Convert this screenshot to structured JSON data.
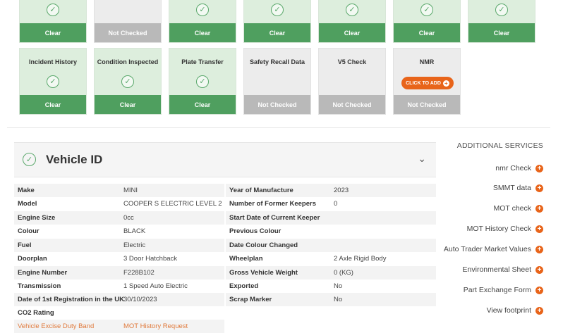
{
  "tiles_row1": [
    {
      "label": "",
      "status": "Clear",
      "checked": true
    },
    {
      "label": "",
      "status": "Not Checked",
      "checked": false
    },
    {
      "label": "",
      "status": "Clear",
      "checked": true
    },
    {
      "label": "",
      "status": "Clear",
      "checked": true
    },
    {
      "label": "",
      "status": "Clear",
      "checked": true
    },
    {
      "label": "",
      "status": "Clear",
      "checked": true
    },
    {
      "label": "",
      "status": "Clear",
      "checked": true
    }
  ],
  "tiles_row2": [
    {
      "label": "Incident History",
      "status": "Clear",
      "checked": true
    },
    {
      "label": "Condition Inspected",
      "status": "Clear",
      "checked": true
    },
    {
      "label": "Plate Transfer",
      "status": "Clear",
      "checked": true
    },
    {
      "label": "Safety Recall Data",
      "status": "Not Checked",
      "checked": false
    },
    {
      "label": "V5 Check",
      "status": "Not Checked",
      "checked": false
    },
    {
      "label": "NMR",
      "status": "Not Checked",
      "checked": false,
      "button": "CLICK TO ADD"
    }
  ],
  "vehicle": {
    "title": "Vehicle ID",
    "left": [
      {
        "k": "Make",
        "v": "MINI"
      },
      {
        "k": "Model",
        "v": "COOPER S ELECTRIC LEVEL 2"
      },
      {
        "k": "Engine Size",
        "v": "0cc"
      },
      {
        "k": "Colour",
        "v": "BLACK"
      },
      {
        "k": "Fuel",
        "v": "Electric"
      },
      {
        "k": "Doorplan",
        "v": "3 Door Hatchback"
      },
      {
        "k": "Engine Number",
        "v": "F228B102"
      },
      {
        "k": "Transmission",
        "v": "1 Speed Auto Electric"
      },
      {
        "k": "Date of 1st Registration in the UK",
        "v": "30/10/2023"
      },
      {
        "k": "CO2 Rating",
        "v": ""
      },
      {
        "k": "Vehicle Excise Duty Band",
        "v": "MOT History Request"
      }
    ],
    "right": [
      {
        "k": "Year of Manufacture",
        "v": "2023"
      },
      {
        "k": "Number of Former Keepers",
        "v": "0"
      },
      {
        "k": "Start Date of Current Keeper",
        "v": ""
      },
      {
        "k": "Previous Colour",
        "v": ""
      },
      {
        "k": "Date Colour Changed",
        "v": ""
      },
      {
        "k": "Wheelplan",
        "v": "2 Axle Rigid Body"
      },
      {
        "k": "Gross Vehicle Weight",
        "v": "0 (KG)"
      },
      {
        "k": "Exported",
        "v": "No"
      },
      {
        "k": "Scrap Marker",
        "v": "No"
      }
    ]
  },
  "sidebar": {
    "title": "ADDITIONAL SERVICES",
    "items": [
      "nmr Check",
      "SMMT data",
      "MOT check",
      "MOT History Check",
      "Auto Trader Market Values",
      "Environmental Sheet",
      "Part Exchange Form",
      "View footprint"
    ]
  }
}
